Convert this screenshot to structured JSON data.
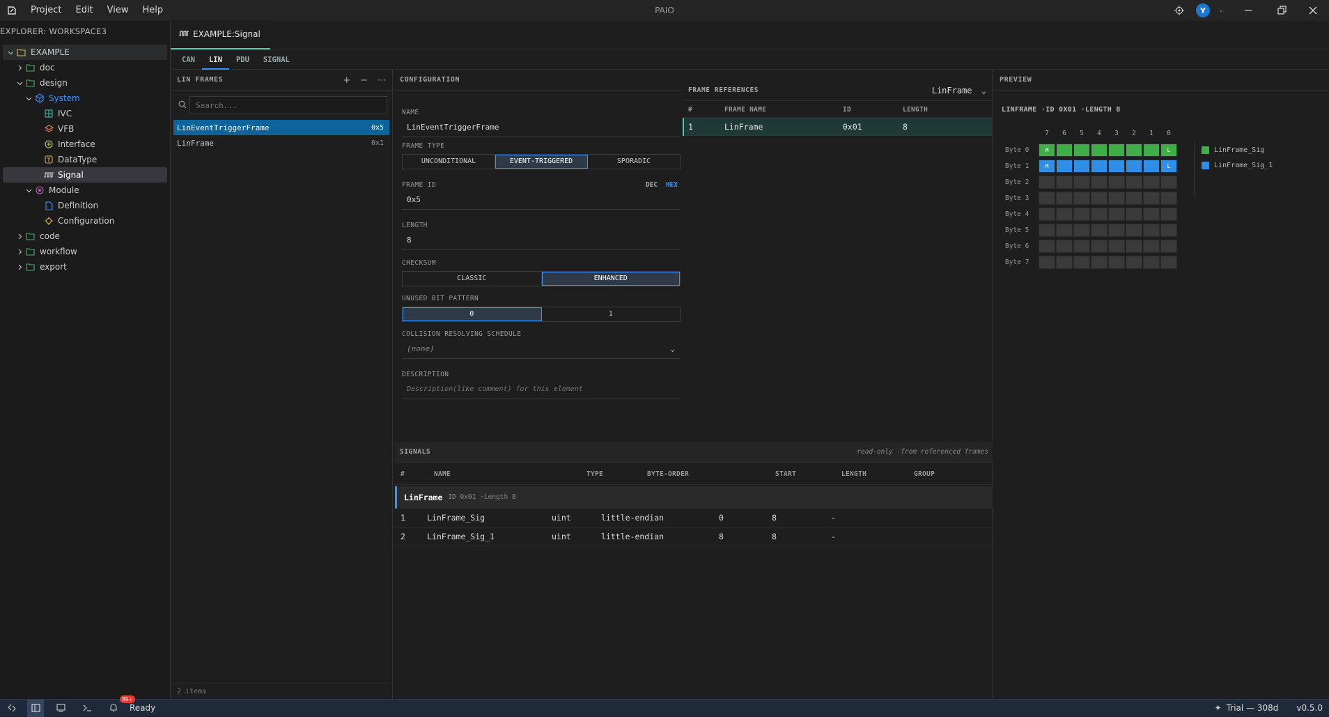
{
  "app": {
    "title": "PAIO",
    "menu": [
      "Project",
      "Edit",
      "View",
      "Help"
    ],
    "avatar": "Y"
  },
  "explorer": {
    "header": "EXPLORER: WORKSPACE3",
    "tree": [
      {
        "label": "EXAMPLE",
        "depth": 0,
        "icon": "folder-open-icon",
        "expanded": true
      },
      {
        "label": "doc",
        "depth": 1,
        "icon": "folder-icon"
      },
      {
        "label": "design",
        "depth": 1,
        "icon": "folder-icon",
        "expanded": true
      },
      {
        "label": "System",
        "depth": 2,
        "icon": "cube-icon",
        "expanded": true
      },
      {
        "label": "IVC",
        "depth": 3,
        "icon": "grid-icon"
      },
      {
        "label": "VFB",
        "depth": 3,
        "icon": "layers-icon"
      },
      {
        "label": "Interface",
        "depth": 3,
        "icon": "plus-circle-icon"
      },
      {
        "label": "DataType",
        "depth": 3,
        "icon": "type-icon"
      },
      {
        "label": "Signal",
        "depth": 3,
        "icon": "signal-icon"
      },
      {
        "label": "Module",
        "depth": 2,
        "icon": "module-icon",
        "expanded": true
      },
      {
        "label": "Definition",
        "depth": 3,
        "icon": "file-icon"
      },
      {
        "label": "Configuration",
        "depth": 3,
        "icon": "gear-icon"
      },
      {
        "label": "code",
        "depth": 1,
        "icon": "folder-icon"
      },
      {
        "label": "workflow",
        "depth": 1,
        "icon": "folder-icon"
      },
      {
        "label": "export",
        "depth": 1,
        "icon": "folder-icon"
      }
    ]
  },
  "editor": {
    "tab": "EXAMPLE:Signal",
    "subtabs": [
      "CAN",
      "LIN",
      "PDU",
      "SIGNAL"
    ],
    "active_subtab": "LIN"
  },
  "lin_frames": {
    "header": "LIN FRAMES",
    "search_placeholder": "Search...",
    "items": [
      {
        "name": "LinEventTriggerFrame",
        "id": "0x5"
      },
      {
        "name": "LinFrame",
        "id": "0x1"
      }
    ],
    "footer": "2 items"
  },
  "configuration": {
    "header": "CONFIGURATION",
    "name_label": "NAME",
    "name_value": "LinEventTriggerFrame",
    "frame_type_label": "FRAME TYPE",
    "frame_types": [
      "UNCONDITIONAL",
      "EVENT-TRIGGERED",
      "SPORADIC"
    ],
    "frame_id_label": "FRAME ID",
    "dec": "DEC",
    "hex": "HEX",
    "frame_id_value": "0x5",
    "length_label": "LENGTH",
    "length_value": "8",
    "checksum_label": "CHECKSUM",
    "checksums": [
      "CLASSIC",
      "ENHANCED"
    ],
    "unused_label": "UNUSED BIT PATTERN",
    "unused": [
      "0",
      "1"
    ],
    "collision_label": "COLLISION RESOLVING SCHEDULE",
    "collision_value": "(none)",
    "desc_label": "DESCRIPTION",
    "desc_placeholder": "Description(like comment) for this element"
  },
  "frame_refs": {
    "header": "FRAME REFERENCES",
    "dropdown": "LinFrame",
    "cols": [
      "#",
      "FRAME NAME",
      "ID",
      "LENGTH"
    ],
    "rows": [
      {
        "n": "1",
        "name": "LinFrame",
        "id": "0x01",
        "len": "8"
      }
    ]
  },
  "signals": {
    "header": "SIGNALS",
    "note": "read-only ·from referenced frames",
    "cols": [
      "#",
      "NAME",
      "TYPE",
      "BYTE-ORDER",
      "START",
      "LENGTH",
      "GROUP"
    ],
    "group_name": "LinFrame",
    "group_meta": "ID 0x01 ·Length 8",
    "rows": [
      {
        "n": "1",
        "name": "LinFrame_Sig",
        "type": "uint",
        "order": "little-endian",
        "start": "0",
        "len": "8",
        "group": "-"
      },
      {
        "n": "2",
        "name": "LinFrame_Sig_1",
        "type": "uint",
        "order": "little-endian",
        "start": "8",
        "len": "8",
        "group": "-"
      }
    ]
  },
  "preview": {
    "header": "PREVIEW",
    "subtitle": "LINFRAME ·ID 0X01 ·LENGTH 8",
    "bits": [
      "7",
      "6",
      "5",
      "4",
      "3",
      "2",
      "1",
      "0"
    ],
    "bytes": [
      "Byte 0",
      "Byte 1",
      "Byte 2",
      "Byte 3",
      "Byte 4",
      "Byte 5",
      "Byte 6",
      "Byte 7"
    ],
    "msb": "M",
    "lsb": "L",
    "legend": [
      {
        "name": "LinFrame_Sig",
        "color": "#3fae49"
      },
      {
        "name": "LinFrame_Sig_1",
        "color": "#2f8fe6"
      }
    ]
  },
  "status": {
    "text": "Ready",
    "badge": "99+",
    "trial": "Trial — 308d",
    "version": "v0.5.0"
  }
}
